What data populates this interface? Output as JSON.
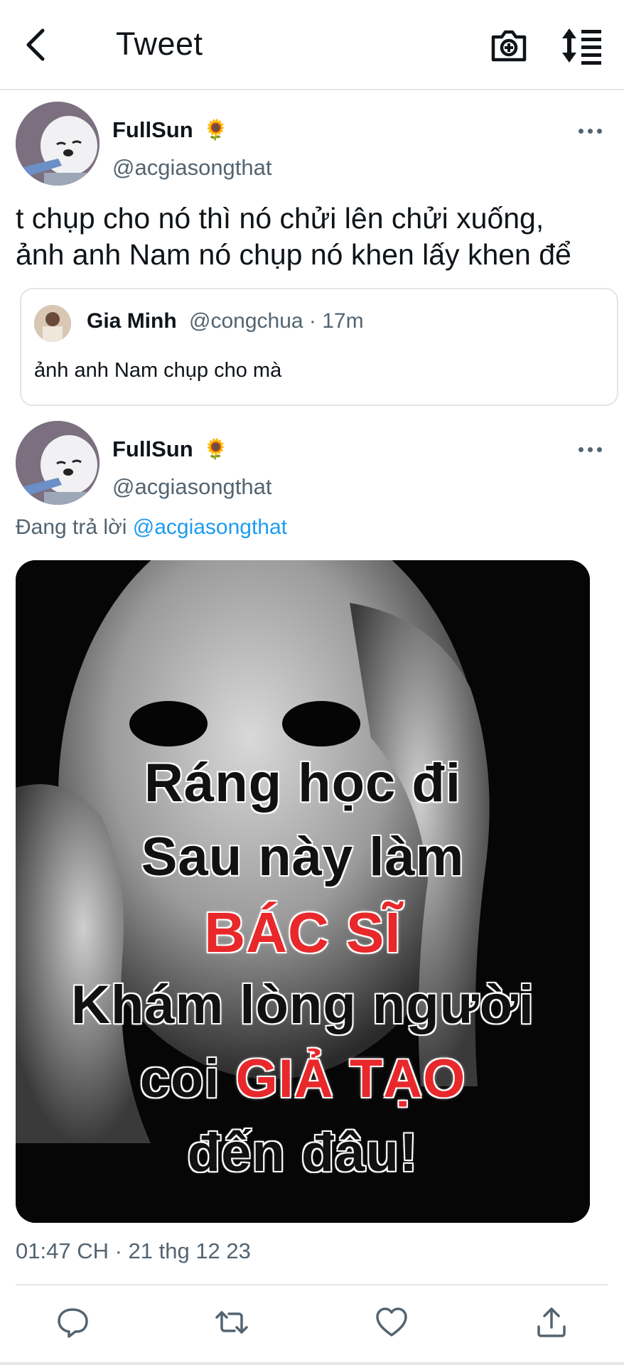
{
  "header": {
    "title": "Tweet",
    "back_icon": "chevron-left-icon",
    "camera_icon": "camera-plus-icon",
    "sort_icon": "sort-lines-icon"
  },
  "tweets": [
    {
      "name": "FullSun",
      "emoji": "🌻",
      "handle": "@acgiasongthat",
      "text_line1": "t chụp cho nó thì nó chửi lên chửi xuống,",
      "text_line2": "ảnh anh Nam nó chụp nó khen lấy khen để",
      "quote": {
        "name": "Gia Minh",
        "meta": "@congchua · 17m",
        "text": "ảnh anh Nam chụp cho mà"
      }
    },
    {
      "name": "FullSun",
      "emoji": "🌻",
      "handle": "@acgiasongthat",
      "reply_prefix": "Đang trả lời",
      "reply_handle": "@acgiasongthat",
      "media_text": {
        "line1": "Ráng học đi",
        "line2": "Sau này làm",
        "line3": "BÁC SĨ",
        "line4": "Khám lòng người",
        "line5a": "coi",
        "line5b": "GIẢ TẠO",
        "line6": "đến đâu!"
      },
      "timestamp": "01:47 CH · 21 thg 12 23"
    }
  ],
  "actions": [
    "reply-icon",
    "retweet-icon",
    "like-icon",
    "share-icon"
  ],
  "colors": {
    "link": "#1d9bf0",
    "secondary": "#536471",
    "meme_red": "#e8282b"
  }
}
